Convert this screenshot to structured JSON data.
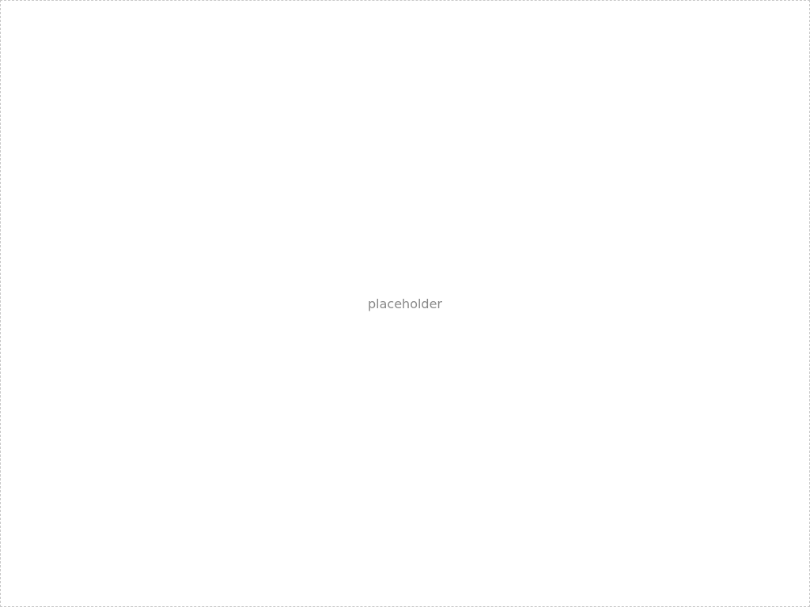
{
  "status": "placeholder"
}
